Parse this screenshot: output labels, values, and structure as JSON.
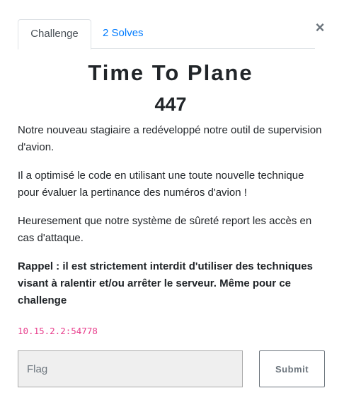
{
  "tabs": {
    "challenge_label": "Challenge",
    "solves_label": "2 Solves"
  },
  "close_glyph": "×",
  "challenge": {
    "name": "Time To Plane",
    "value": "447",
    "description": [
      "Notre nouveau stagiaire a redéveloppé notre outil de supervision d'avion.",
      "Il a optimisé le code en utilisant une toute nouvelle technique pour évaluer la pertinance des numéros d'avion !",
      "Heuresement que notre système de sûreté report les accès en cas d'attaque.",
      "Rappel : il est strictement interdit d'utiliser des techniques visant à ralentir et/ou arrêter le serveur. Même pour ce challenge"
    ],
    "connection": "10.15.2.2:54778"
  },
  "form": {
    "flag_placeholder": "Flag",
    "flag_value": "",
    "submit_label": "Submit"
  },
  "colors": {
    "link": "#007bff",
    "code": "#e83e8c",
    "input_bg": "#efefef",
    "submit_border": "#6c757d"
  },
  "icons": {
    "close": "close-icon"
  }
}
